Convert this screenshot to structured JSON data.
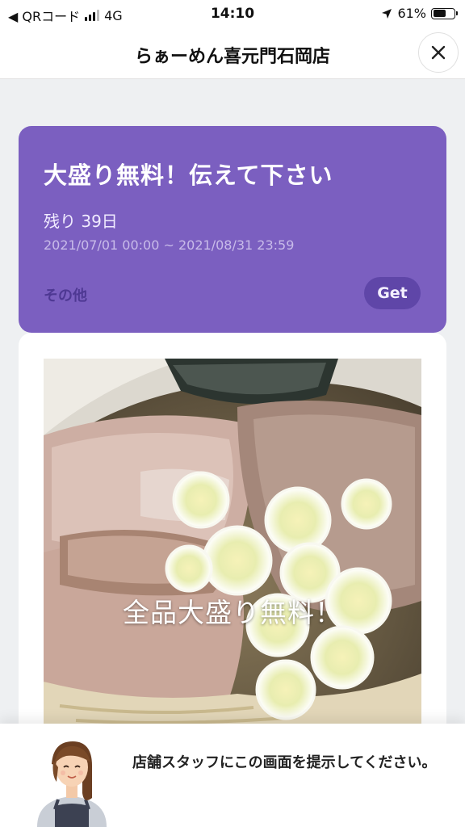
{
  "status_bar": {
    "back_app": "◀ QRコード",
    "network": "4G",
    "time": "14:10",
    "battery_percent": "61%",
    "battery_level": 0.61
  },
  "header": {
    "title": "らぁーめん喜元門石岡店"
  },
  "coupon": {
    "title": "大盛り無料！伝えて下さい",
    "remaining": "残り 39日",
    "period": "2021/07/01 00:00 ~ 2021/08/31 23:59",
    "category": "その他",
    "get_label": "Get",
    "card_color": "#7b5fc0"
  },
  "detail": {
    "image_caption": "全品大盛り無料！"
  },
  "bottom_sheet": {
    "message": "店舗スタッフにこの画面を提示してください。"
  }
}
